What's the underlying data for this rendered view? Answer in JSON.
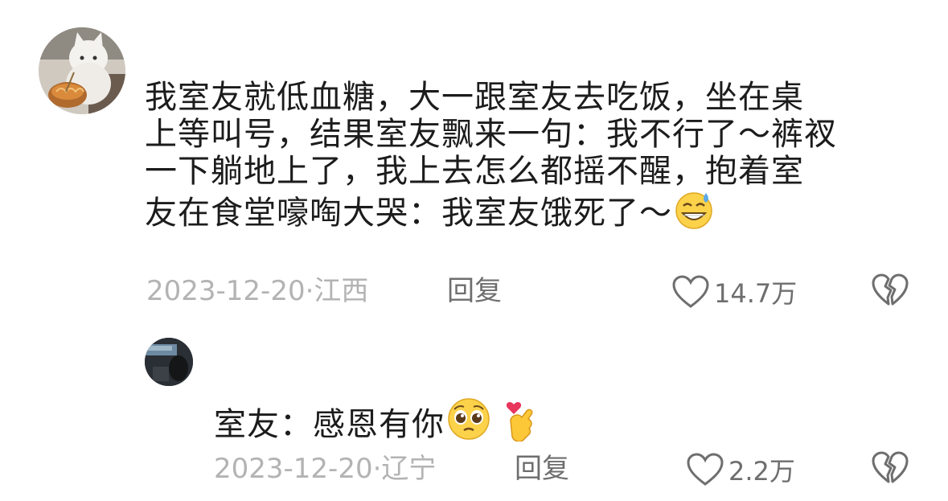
{
  "main_comment": {
    "avatar_icon": "cat-eating-noodles-avatar",
    "text_lines": [
      "我室友就低血糖，大一跟室友去吃饭，坐在桌",
      "上等叫号，结果室友飘来一句：我不行了～裤衩",
      "一下躺地上了，我上去怎么都摇不醒，抱着室",
      "友在食堂嚎啕大哭：我室友饿死了～"
    ],
    "trailing_emoji": "grinning-sweat-emoji",
    "date_location": "2023-12-20·江西",
    "reply_label": "回复",
    "like_count": "14.7万",
    "like_icon": "heart-outline-icon",
    "dislike_icon": "broken-heart-icon"
  },
  "reply_comment": {
    "avatar_icon": "dark-photo-avatar",
    "text": "室友：感恩有你",
    "emojis": [
      "pleading-face-emoji",
      "finger-heart-emoji"
    ],
    "date_location": "2023-12-20·辽宁",
    "reply_label": "回复",
    "like_count": "2.2万",
    "like_icon": "heart-outline-icon",
    "dislike_icon": "broken-heart-icon"
  },
  "colors": {
    "text": "#1c1c1c",
    "meta": "#b3b3b3",
    "action": "#6e6e6e"
  }
}
